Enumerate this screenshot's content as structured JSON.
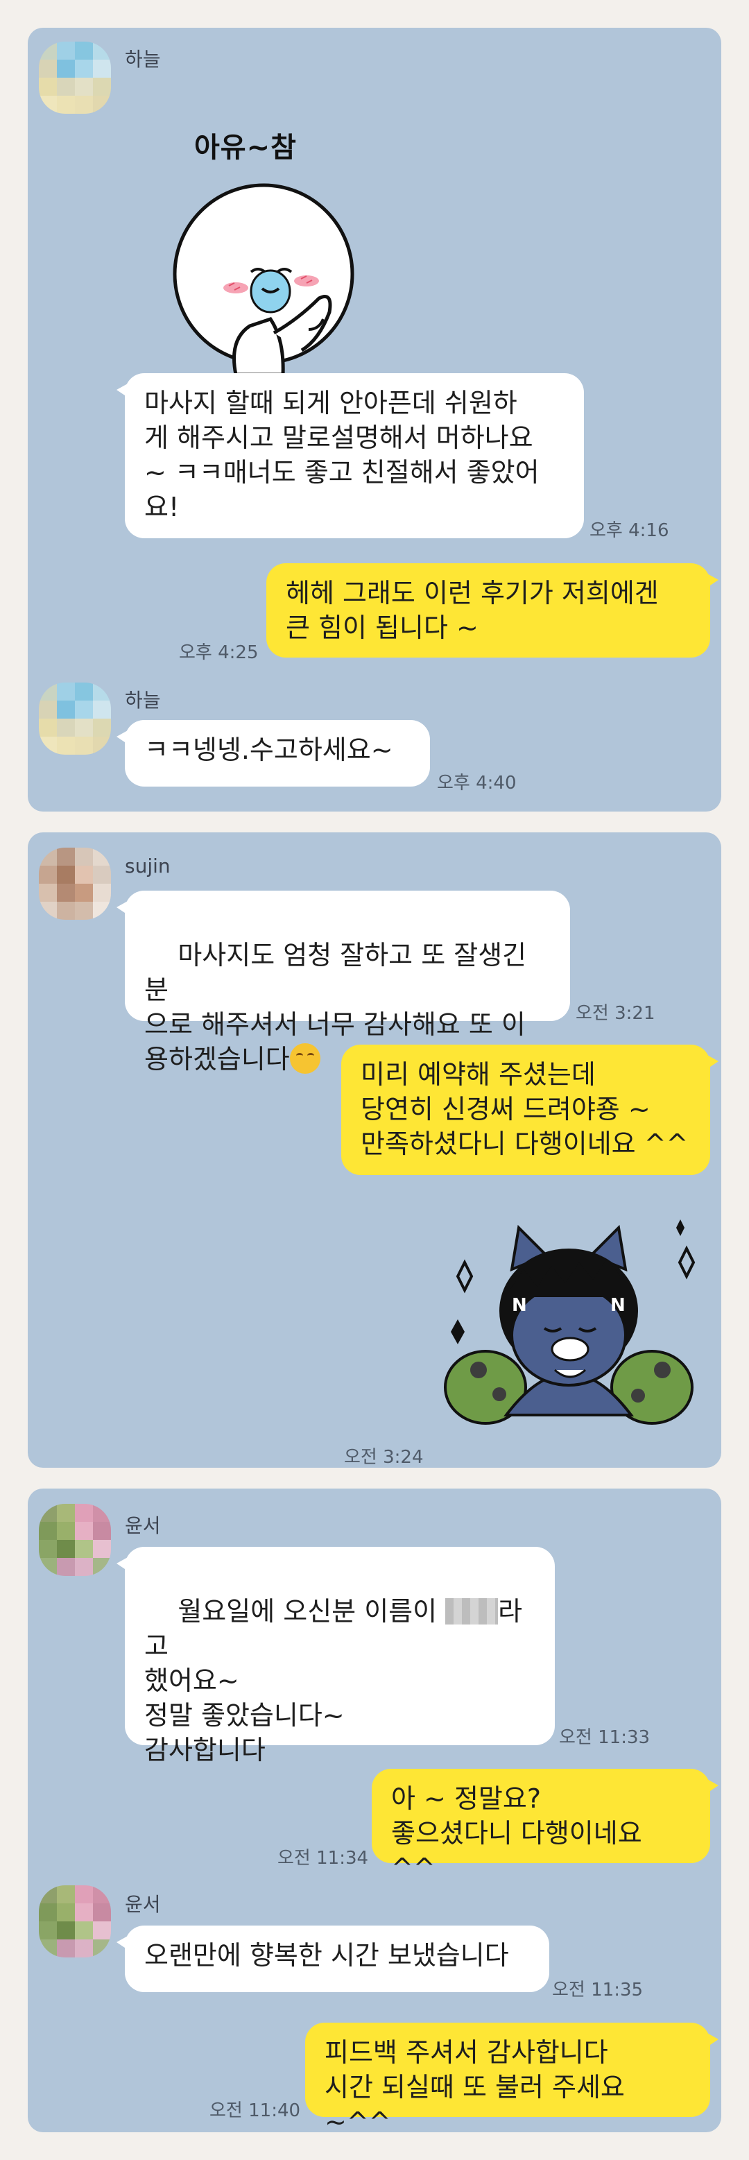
{
  "chat1": {
    "sender_name": "하늘",
    "sticker_text": "아유~참",
    "msg1": "마사지 할때 되게 안아픈데 쉬원하\n게 해주시고 말로설명해서 머하나요\n~ ㅋㅋ매너도 좋고 친절해서 좋았어\n요!",
    "msg1_time": "오후 4:16",
    "reply1": "헤헤 그래도 이런 후기가 저희에겐\n큰 힘이 됩니다 ~",
    "reply1_time": "오후 4:25",
    "sender_name_2": "하늘",
    "msg2": "ㅋㅋ넹넹.수고하세요~",
    "msg2_time": "오후 4:40"
  },
  "chat2": {
    "sender_name": "sujin",
    "msg1": "마사지도 엄청 잘하고 또 잘생긴 분\n으로 해주셔서 너무 감사해요 또 이\n용하겠습니다",
    "msg1_time": "오전 3:21",
    "reply1": "미리 예약해 주셨는데\n당연히 신경써 드려야죵 ~\n만족하셨다니 다행이네요 ^^",
    "sticker_time": "오전 3:24"
  },
  "chat3": {
    "sender_name": "윤서",
    "msg1_part1": "월요일에 오신분 이름이 ",
    "msg1_part2": "라고\n했어요~\n정말 좋았습니다~\n감사합니다",
    "msg1_time": "오전 11:33",
    "reply1": "아 ~ 정말요?\n좋으셨다니 다행이네요 ^^",
    "reply1_time": "오전 11:34",
    "sender_name_2": "윤서",
    "msg2": "오랜만에 향복한 시간 보냈습니다",
    "msg2_time": "오전 11:35",
    "reply2": "피드백 주셔서 감사합니다\n시간 되실때 또 불러 주세요 ~^^",
    "reply2_time": "오전 11:40"
  },
  "colors": {
    "chat_background": "#b1c5d9",
    "my_bubble": "#fee635",
    "their_bubble": "#ffffff",
    "page_background": "#f3f0ec"
  },
  "icons": {
    "avatar": "blurred-profile-photo",
    "sticker1": "shy-white-blob-sticker",
    "sticker2": "kakao-friends-cat-bowing-sticker",
    "emoji": "smiling-face-emoji"
  }
}
